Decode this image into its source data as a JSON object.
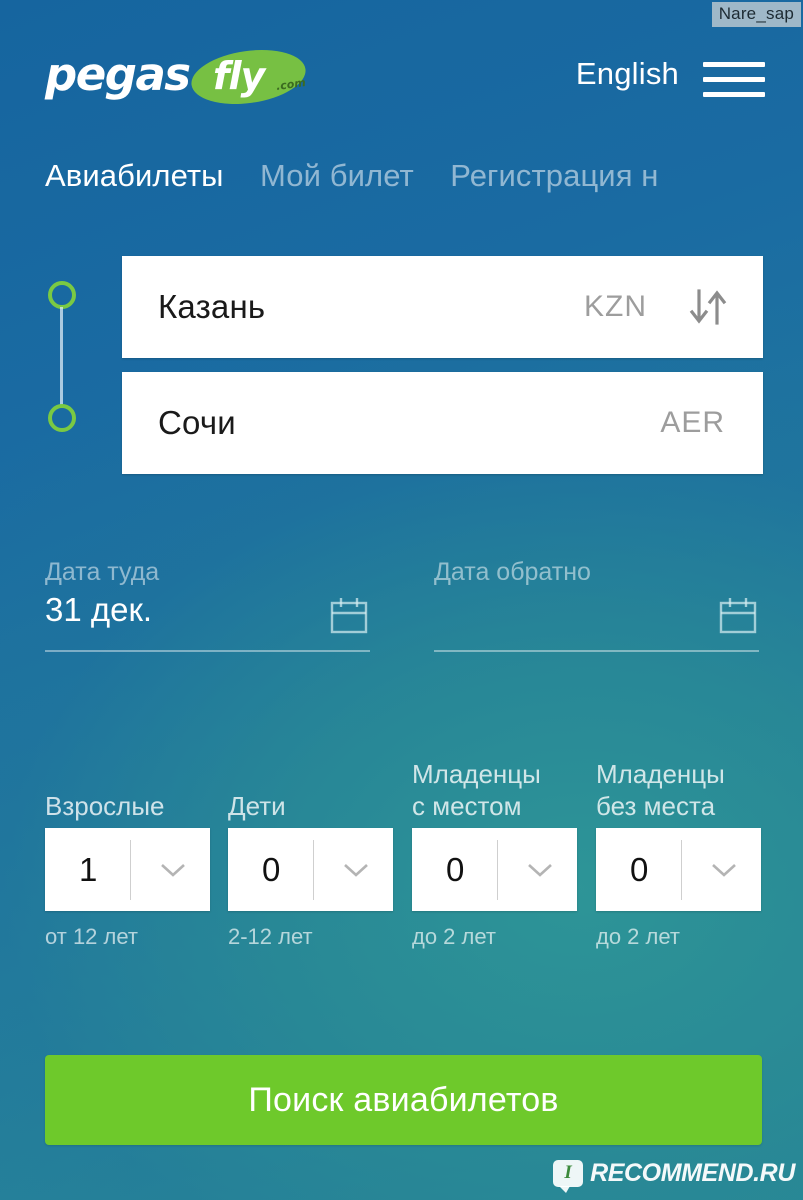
{
  "watermarks": {
    "user": "Nare_sap",
    "site": "RECOMMEND.RU",
    "site_badge": "I"
  },
  "header": {
    "logo_main": "pegas",
    "logo_accent": "fly",
    "logo_tld": ".com",
    "language": "English",
    "menu_icon": "hamburger-icon",
    "accent_green": "#77c043",
    "background_blue": "#1c6fa5",
    "background_teal": "#2e9697"
  },
  "tabs": [
    {
      "label": "Авиабилеты",
      "active": true
    },
    {
      "label": "Мой билет",
      "active": false
    },
    {
      "label": "Регистрация н",
      "active": false
    }
  ],
  "route": {
    "from": {
      "city": "Казань",
      "code": "KZN"
    },
    "to": {
      "city": "Сочи",
      "code": "AER"
    },
    "swap_icon": "swap-vertical-icon",
    "marker_color": "#7ac943"
  },
  "dates": {
    "there": {
      "label": "Дата туда",
      "value": "31 дек.",
      "placeholder": "",
      "icon": "calendar-icon"
    },
    "back": {
      "label": "Дата обратно",
      "value": "",
      "placeholder": "",
      "icon": "calendar-icon"
    }
  },
  "passengers": [
    {
      "label": "Взрослые",
      "value": "1",
      "hint": "от 12 лет"
    },
    {
      "label": "Дети",
      "value": "0",
      "hint": "2-12 лет"
    },
    {
      "label": "Младенцы\nс местом",
      "value": "0",
      "hint": "до 2 лет"
    },
    {
      "label": "Младенцы\nбез места",
      "value": "0",
      "hint": "до 2 лет"
    }
  ],
  "search": {
    "label": "Поиск авиабилетов",
    "color": "#6ec92b"
  }
}
